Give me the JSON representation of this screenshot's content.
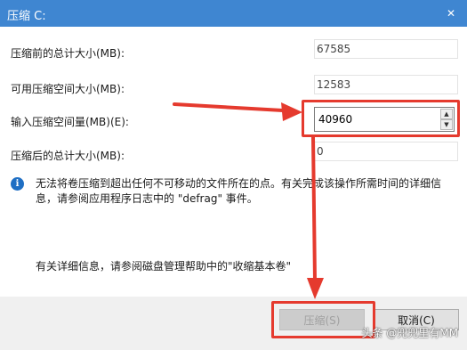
{
  "window": {
    "title": "压缩 C:",
    "close_glyph": "✕"
  },
  "fields": {
    "total_before_label": "压缩前的总计大小(MB):",
    "total_before_value": "67585",
    "available_label": "可用压缩空间大小(MB):",
    "available_value": "12583",
    "input_label": "输入压缩空间量(MB)(E):",
    "input_value": "40960",
    "total_after_label": "压缩后的总计大小(MB):",
    "total_after_value": "0"
  },
  "info": {
    "icon_glyph": "i",
    "message": "无法将卷压缩到超出任何不可移动的文件所在的点。有关完成该操作所需时间的详细信息，请参阅应用程序日志中的 \"defrag\" 事件。"
  },
  "help": {
    "text": "有关详细信息，请参阅磁盘管理帮助中的\"收缩基本卷\""
  },
  "buttons": {
    "shrink_label": "压缩(S)",
    "cancel_label": "取消(C)"
  },
  "watermark": {
    "text": "头条 @兜兜里有MM"
  },
  "colors": {
    "titlebar": "#3f86d1",
    "annotation_red": "#e53a2e",
    "info_blue": "#1f6fc4"
  },
  "icons": {
    "close": "close-icon",
    "info": "info-icon",
    "spin_up": "chevron-up-icon",
    "spin_down": "chevron-down-icon"
  }
}
